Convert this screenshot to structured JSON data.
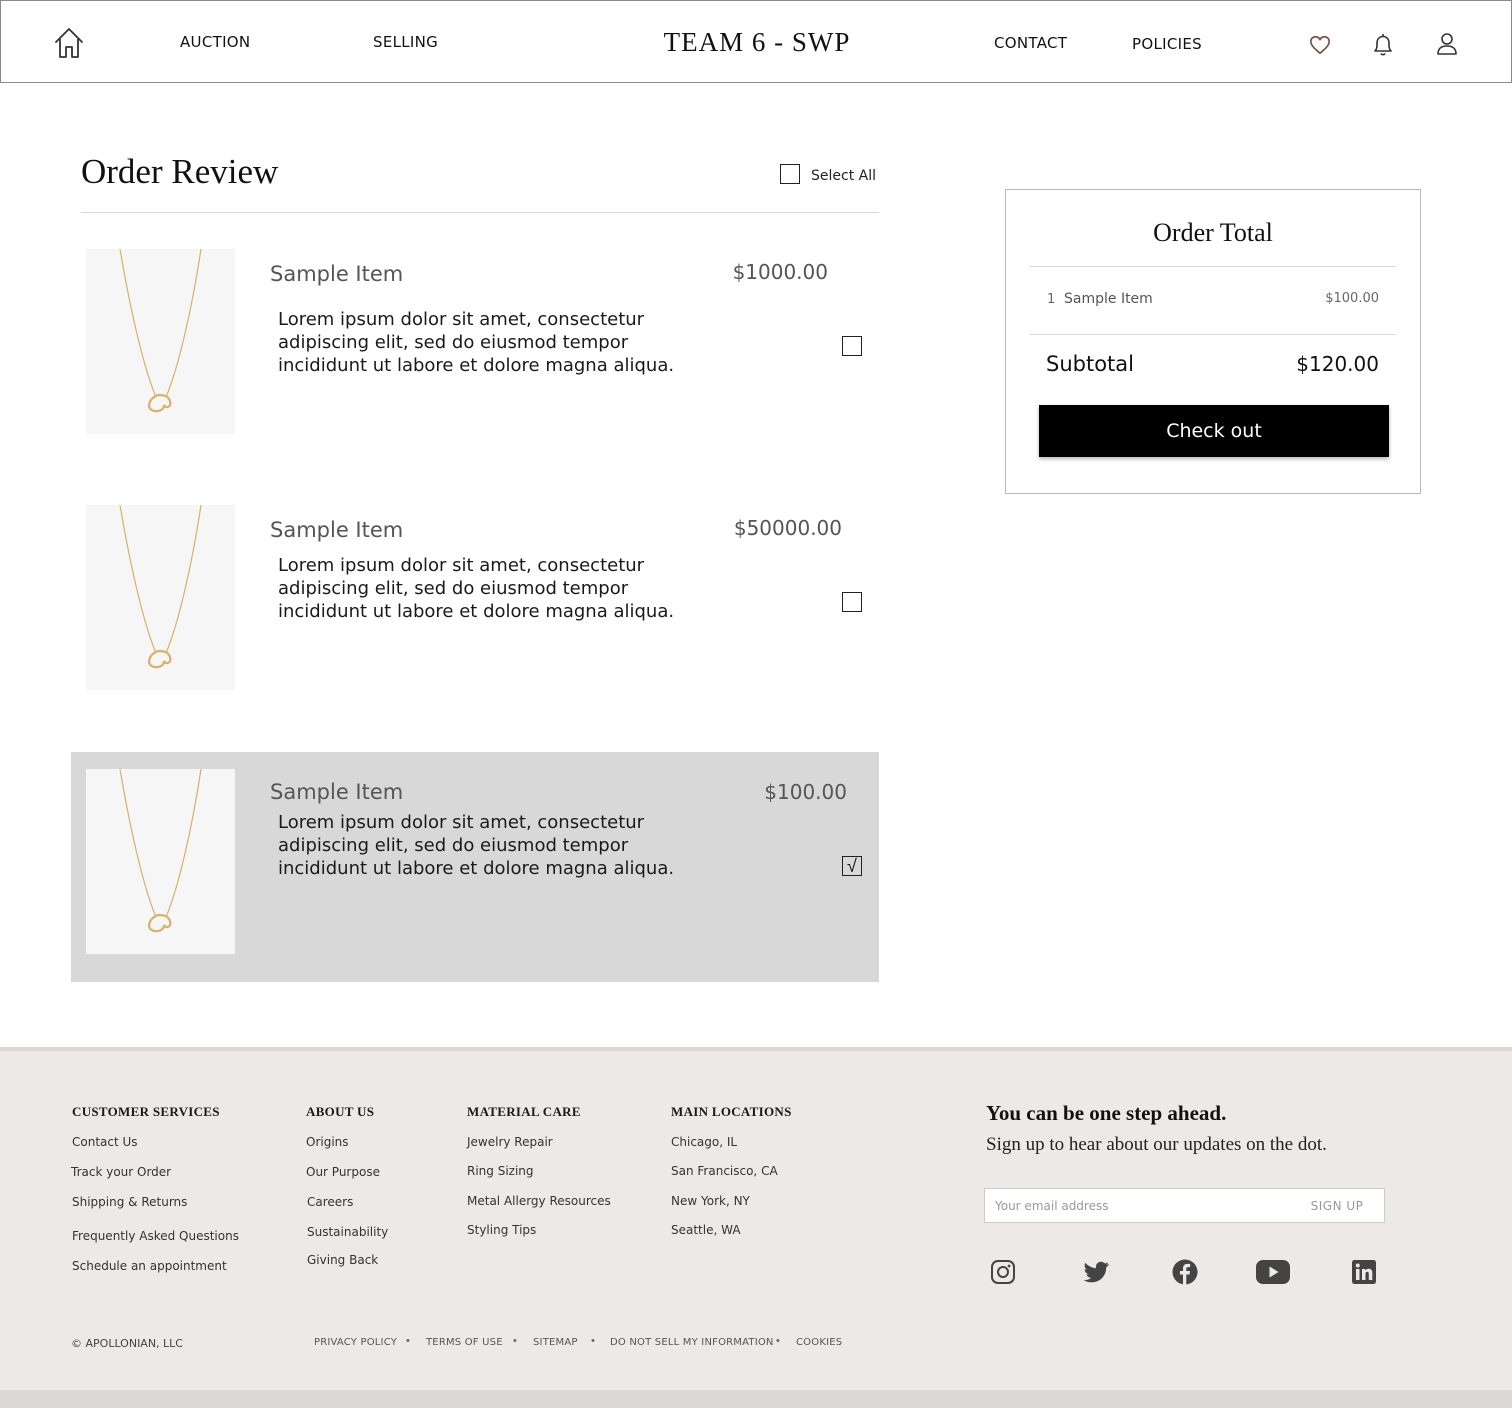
{
  "header": {
    "brand": "TEAM 6 - SWP",
    "nav_left": [
      "AUCTION",
      "SELLING"
    ],
    "nav_right": [
      "CONTACT",
      "POLICIES"
    ],
    "icons": [
      "home-icon",
      "heart-icon",
      "bell-icon",
      "user-icon"
    ]
  },
  "order_review": {
    "title": "Order Review",
    "select_all_label": "Select All",
    "select_all_checked": false,
    "items": [
      {
        "name": "Sample Item",
        "price": "$1000.00",
        "description": "Lorem ipsum dolor sit amet, consectetur adipiscing elit, sed do eiusmod tempor incididunt ut labore et dolore magna aliqua.",
        "checked": false,
        "check_mark": ""
      },
      {
        "name": "Sample Item",
        "price": "$50000.00",
        "description": "Lorem ipsum dolor sit amet, consectetur adipiscing elit, sed do eiusmod tempor incididunt ut labore et dolore magna aliqua.",
        "checked": false,
        "check_mark": ""
      },
      {
        "name": "Sample Item",
        "price": "$100.00",
        "description": "Lorem ipsum dolor sit amet, consectetur adipiscing elit, sed do eiusmod tempor incididunt ut labore et dolore magna aliqua.",
        "checked": true,
        "check_mark": "√"
      }
    ]
  },
  "order_total": {
    "title": "Order Total",
    "lines": [
      {
        "qty": "1",
        "name": "Sample Item",
        "price": "$100.00"
      }
    ],
    "subtotal_label": "Subtotal",
    "subtotal_value": "$120.00",
    "checkout_label": "Check out"
  },
  "footer": {
    "columns": [
      {
        "title": "CUSTOMER SERVICES",
        "links": [
          "Contact Us",
          "Track your Order",
          "Shipping & Returns",
          "Frequently Asked Questions",
          "Schedule an appointment"
        ]
      },
      {
        "title": "ABOUT US",
        "links": [
          "Origins",
          "Our Purpose",
          "Careers",
          "Sustainability",
          "Giving Back"
        ]
      },
      {
        "title": "MATERIAL CARE",
        "links": [
          "Jewelry Repair",
          "Ring Sizing",
          "Metal Allergy Resources",
          "Styling Tips"
        ]
      },
      {
        "title": "MAIN LOCATIONS",
        "links": [
          "Chicago, IL",
          "San Francisco, CA",
          "New York, NY",
          "Seattle, WA"
        ]
      }
    ],
    "newsletter": {
      "heading": "You can be one step ahead.",
      "subheading": "Sign up to hear about our updates on the dot.",
      "email_placeholder": "Your email address",
      "signup_label": "SIGN UP"
    },
    "social_icons": [
      "instagram-icon",
      "twitter-icon",
      "facebook-icon",
      "youtube-icon",
      "linkedin-icon"
    ],
    "copyright": "©   APOLLONIAN, LLC",
    "legal_links": [
      "PRIVACY POLICY",
      "TERMS OF USE",
      "SITEMAP",
      "DO NOT SELL MY INFORMATION",
      "COOKIES"
    ]
  },
  "colors": {
    "checkout_bg": "#000000",
    "selected_row_bg": "#d8d8d8",
    "footer_bg": "#ede9e6",
    "pendant_gold": "#d8b06a"
  }
}
